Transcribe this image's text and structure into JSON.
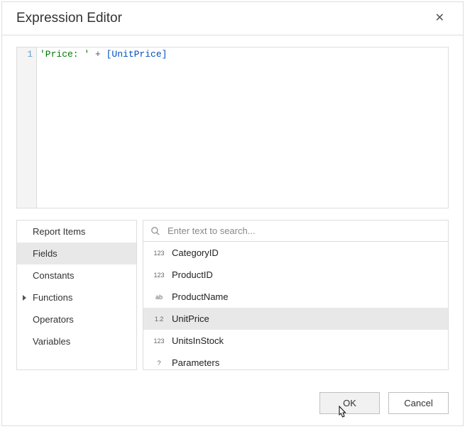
{
  "title": "Expression Editor",
  "editor": {
    "line_number": "1",
    "tokens": {
      "string": "'Price: '",
      "op": " + ",
      "field": "[UnitPrice]"
    }
  },
  "categories": [
    {
      "label": "Report Items",
      "selected": false,
      "hasChildren": false
    },
    {
      "label": "Fields",
      "selected": true,
      "hasChildren": false
    },
    {
      "label": "Constants",
      "selected": false,
      "hasChildren": false
    },
    {
      "label": "Functions",
      "selected": false,
      "hasChildren": true
    },
    {
      "label": "Operators",
      "selected": false,
      "hasChildren": false
    },
    {
      "label": "Variables",
      "selected": false,
      "hasChildren": false
    }
  ],
  "search": {
    "placeholder": "Enter text to search..."
  },
  "members": [
    {
      "icon": "123",
      "label": "CategoryID",
      "selected": false
    },
    {
      "icon": "123",
      "label": "ProductID",
      "selected": false
    },
    {
      "icon": "ab",
      "label": "ProductName",
      "selected": false
    },
    {
      "icon": "1.2",
      "label": "UnitPrice",
      "selected": true
    },
    {
      "icon": "123",
      "label": "UnitsInStock",
      "selected": false
    },
    {
      "icon": "?",
      "label": "Parameters",
      "selected": false
    }
  ],
  "buttons": {
    "ok": "OK",
    "cancel": "Cancel"
  }
}
